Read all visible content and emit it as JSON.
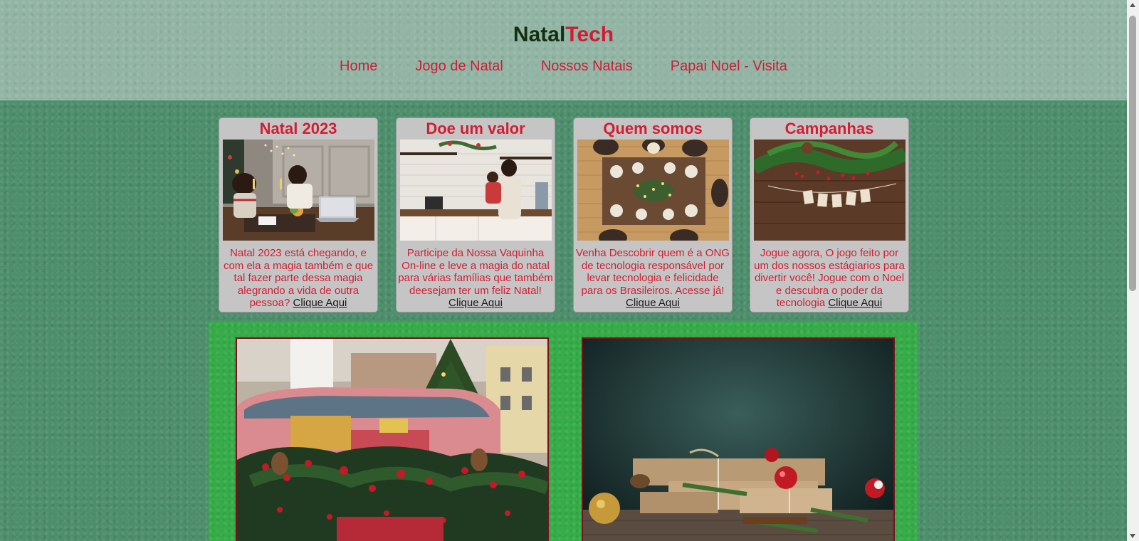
{
  "header": {
    "brand_part1": "Natal",
    "brand_part2": "Tech",
    "nav": [
      "Home",
      "Jogo de Natal",
      "Nossos Natais",
      "Papai Noel - Visita"
    ]
  },
  "cards": [
    {
      "title": "Natal 2023",
      "text": "Natal 2023 está chegando, e com ela a magia também e que tal fazer parte dessa magia alegrando a vida de outra pessoa?",
      "link": "Clique Aqui"
    },
    {
      "title": "Doe um valor",
      "text": "Participe da Nossa Vaquinha On-line e leve a magia do natal para várias famílias que também deesejam ter um feliz Natal!",
      "link": "Clique Aqui"
    },
    {
      "title": "Quem somos",
      "text": "Venha Descobrir quem é a ONG de tecnologia responsável por levar tecnologia e felicidade para os Brasileiros. Acesse já!",
      "link": "Clique Aqui"
    },
    {
      "title": "Campanhas",
      "text": "Jogue agora, O jogo feito por um dos nossos estágiarios para divertir você! Jogue com o Noel e descubra o poder da tecnologia",
      "link": "Clique Aqui"
    }
  ],
  "colors": {
    "accent": "#cf1d36",
    "brand_dark": "#15300f",
    "page_bg": "#4d8e6c",
    "header_bg": "#92b5a5",
    "card_bg": "#c5c5c5",
    "green_section": "#36ad49"
  }
}
